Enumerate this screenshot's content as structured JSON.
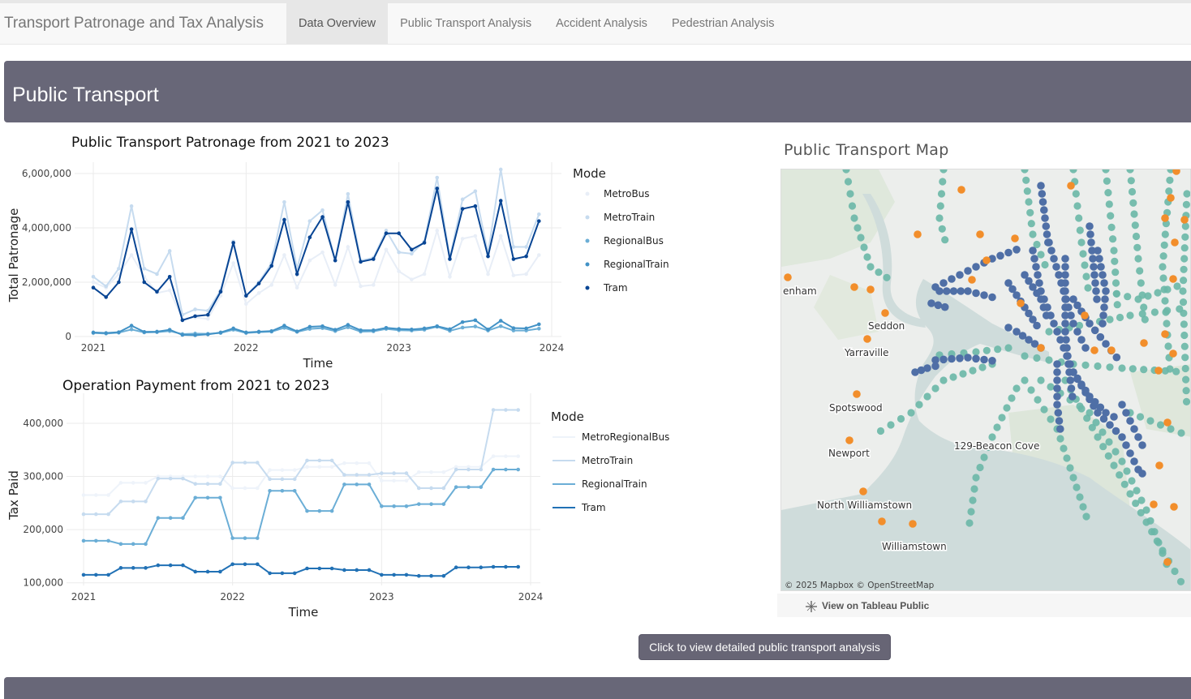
{
  "navbar": {
    "brand": "Transport Patronage and Tax Analysis",
    "tabs": [
      "Data Overview",
      "Public Transport Analysis",
      "Accident Analysis",
      "Pedestrian Analysis"
    ],
    "active_tab": "Data Overview"
  },
  "section": {
    "title": "Public Transport"
  },
  "map": {
    "title": "Public Transport Map",
    "labels": [
      "enham",
      "Seddon",
      "Yarraville",
      "Spotswood",
      "Newport",
      "129-Beacon Cove",
      "North Williamstown",
      "Williamstown"
    ],
    "attribution": "© 2025 Mapbox  © OpenStreetMap",
    "tableau_link": "View on Tableau Public",
    "colors": {
      "tram": "#4f6fa6",
      "train": "#6ab7a7",
      "bus": "#f28e2b"
    }
  },
  "button": {
    "label": "Click to view detailed public transport analysis"
  },
  "chart_data": [
    {
      "type": "line",
      "title": "Public Transport Patronage from 2021 to 2023",
      "xlabel": "Time",
      "ylabel": "Total Patronage",
      "x_ticks": [
        "2021",
        "2022",
        "2023",
        "2024"
      ],
      "y_ticks": [
        "0",
        "2,000,000",
        "4,000,000",
        "6,000,000"
      ],
      "ylim": [
        0,
        6000000
      ],
      "legend_title": "Mode",
      "legend_position": "right",
      "x_start": "2021-01",
      "series": [
        {
          "name": "MetroBus",
          "color": "#e8eef7",
          "values": [
            2000000,
            1800000,
            2300000,
            3000000,
            2200000,
            1600000,
            1700000,
            650000,
            700000,
            650000,
            1500000,
            2700000,
            1200000,
            1600000,
            1900000,
            3000000,
            1800000,
            2800000,
            3100000,
            1900000,
            3300000,
            1850000,
            1900000,
            3200000,
            2400000,
            2100000,
            2300000,
            3900000,
            2200000,
            3600000,
            3700000,
            2300000,
            3700000,
            2250000,
            2300000,
            3000000
          ]
        },
        {
          "name": "MetroTrain",
          "color": "#c6dbef",
          "values": [
            2200000,
            1850000,
            2500000,
            4800000,
            2500000,
            2300000,
            3150000,
            800000,
            1000000,
            950000,
            1700000,
            3500000,
            1500000,
            2000000,
            2700000,
            4950000,
            2500000,
            4250000,
            4650000,
            2800000,
            5250000,
            2800000,
            2900000,
            3900000,
            3100000,
            3050000,
            3500000,
            5850000,
            2900000,
            5050000,
            5350000,
            3050000,
            6150000,
            3300000,
            3300000,
            4500000
          ]
        },
        {
          "name": "RegionalBus",
          "color": "#6baed6",
          "values": [
            130000,
            110000,
            140000,
            260000,
            150000,
            160000,
            200000,
            90000,
            110000,
            100000,
            130000,
            250000,
            130000,
            160000,
            180000,
            320000,
            170000,
            280000,
            310000,
            200000,
            340000,
            180000,
            190000,
            280000,
            230000,
            220000,
            250000,
            360000,
            210000,
            330000,
            370000,
            220000,
            380000,
            220000,
            220000,
            290000
          ]
        },
        {
          "name": "RegionalTrain",
          "color": "#4292c6",
          "values": [
            150000,
            130000,
            160000,
            400000,
            170000,
            180000,
            250000,
            60000,
            50000,
            80000,
            150000,
            300000,
            150000,
            180000,
            200000,
            400000,
            190000,
            360000,
            380000,
            250000,
            430000,
            230000,
            230000,
            320000,
            280000,
            260000,
            300000,
            380000,
            270000,
            530000,
            600000,
            260000,
            580000,
            310000,
            300000,
            450000
          ]
        },
        {
          "name": "Tram",
          "color": "#084594",
          "values": [
            1800000,
            1450000,
            2000000,
            3950000,
            2000000,
            1650000,
            2200000,
            600000,
            750000,
            800000,
            1650000,
            3450000,
            1500000,
            1950000,
            2600000,
            4300000,
            2300000,
            3650000,
            4400000,
            2800000,
            4950000,
            2750000,
            2850000,
            3800000,
            3800000,
            3200000,
            3450000,
            5450000,
            2850000,
            4700000,
            4800000,
            2950000,
            5000000,
            2850000,
            2950000,
            4250000
          ]
        }
      ]
    },
    {
      "type": "line",
      "title": "Operation Payment from 2021 to 2023",
      "xlabel": "Time",
      "ylabel": "Tax Paid",
      "x_ticks": [
        "2021",
        "2022",
        "2023",
        "2024"
      ],
      "y_ticks": [
        "100,000",
        "200,000",
        "300,000",
        "400,000"
      ],
      "ylim": [
        95000,
        435000
      ],
      "legend_title": "Mode",
      "legend_position": "right",
      "x_start": "2021-01",
      "series": [
        {
          "name": "MetroRegionalBus",
          "color": "#eef3fa",
          "values": [
            265000,
            265000,
            265000,
            288000,
            288000,
            288000,
            300000,
            300000,
            300000,
            300000,
            300000,
            300000,
            278000,
            278000,
            278000,
            312000,
            312000,
            312000,
            318000,
            318000,
            318000,
            325000,
            325000,
            325000,
            292000,
            292000,
            292000,
            308000,
            308000,
            308000,
            318000,
            318000,
            318000,
            338000,
            338000,
            338000
          ]
        },
        {
          "name": "MetroTrain",
          "color": "#c6dbef",
          "values": [
            229000,
            229000,
            229000,
            253000,
            253000,
            253000,
            296000,
            296000,
            296000,
            286000,
            286000,
            286000,
            326000,
            326000,
            326000,
            295000,
            295000,
            295000,
            330000,
            330000,
            330000,
            303000,
            303000,
            303000,
            306000,
            306000,
            306000,
            278000,
            278000,
            278000,
            313000,
            313000,
            313000,
            425000,
            425000,
            425000
          ]
        },
        {
          "name": "RegionalTrain",
          "color": "#6baed6",
          "values": [
            179000,
            179000,
            179000,
            173000,
            173000,
            173000,
            222000,
            222000,
            222000,
            260000,
            260000,
            260000,
            184000,
            184000,
            184000,
            273000,
            273000,
            273000,
            235000,
            235000,
            235000,
            285000,
            285000,
            285000,
            244000,
            244000,
            244000,
            248000,
            248000,
            248000,
            280000,
            280000,
            280000,
            313000,
            313000,
            313000
          ]
        },
        {
          "name": "Tram",
          "color": "#2171b5",
          "values": [
            115000,
            115000,
            115000,
            128000,
            128000,
            128000,
            133000,
            133000,
            133000,
            121000,
            121000,
            121000,
            135000,
            135000,
            135000,
            118000,
            118000,
            118000,
            127000,
            127000,
            127000,
            124000,
            124000,
            124000,
            115000,
            115000,
            115000,
            113000,
            113000,
            113000,
            129000,
            129000,
            129000,
            130000,
            130000,
            130000
          ]
        }
      ]
    }
  ]
}
